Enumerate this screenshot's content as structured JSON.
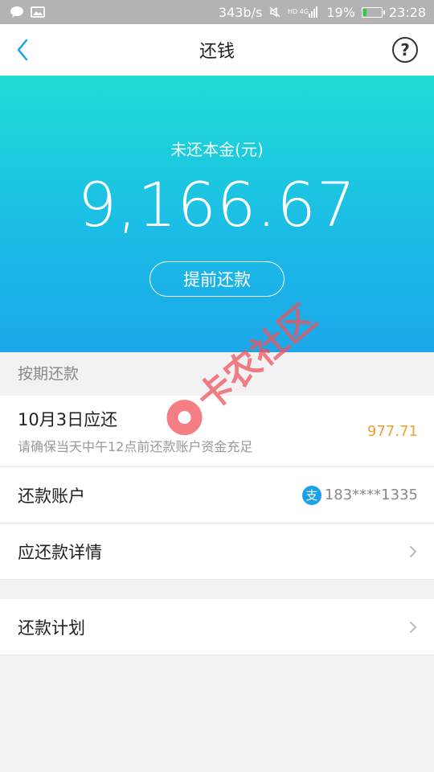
{
  "status_bar": {
    "speed": "343b/s",
    "battery": "19%",
    "battery_level": 0.19,
    "time": "23:28",
    "icons": [
      "chat-icon",
      "image-icon",
      "mute-icon",
      "signal-icon",
      "battery-icon"
    ]
  },
  "nav": {
    "title": "还钱",
    "back_icon": "chevron-left-icon",
    "help_icon": "help-icon"
  },
  "hero": {
    "label": "未还本金(元)",
    "amount": "9,166.67",
    "prepay_button": "提前还款"
  },
  "schedule_section": {
    "header": "按期还款",
    "due_title": "10月3日应还",
    "due_subtitle": "请确保当天中午12点前还款账户资金充足",
    "due_amount": "977.71",
    "account_label": "还款账户",
    "account_value": "183****1335",
    "account_icon_glyph": "支",
    "details_label": "应还款详情"
  },
  "plan_section": {
    "plan_label": "还款计划"
  },
  "watermark": {
    "text": "卡农社区"
  },
  "colors": {
    "hero_top": "#1fdcd5",
    "hero_bottom": "#1ba7ea",
    "accent_blue": "#1a9fe8",
    "amount_orange": "#f0a032",
    "watermark": "#f0545c"
  }
}
